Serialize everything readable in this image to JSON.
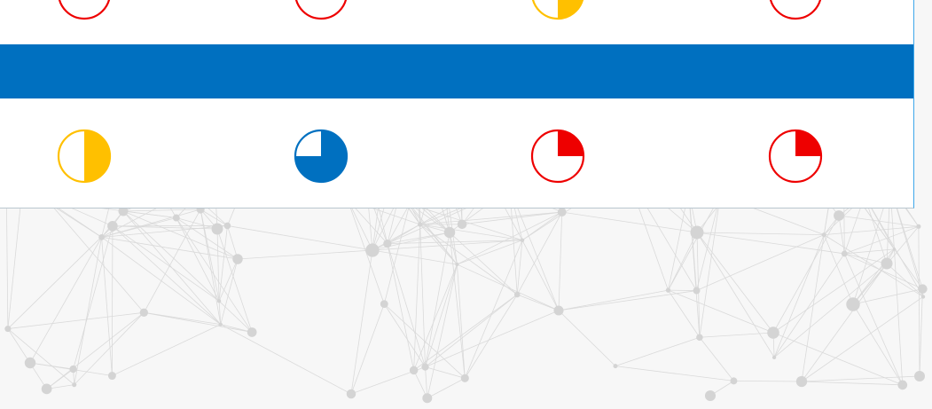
{
  "colors": {
    "band": "#0070c0",
    "yellow": "#ffc000",
    "blue": "#0070c0",
    "red": "#ee0000",
    "panel_border": "#3ea7ea"
  },
  "rows": [
    {
      "name": "top-row",
      "cells": [
        {
          "fill": 0,
          "color": "red"
        },
        {
          "fill": 0,
          "color": "red"
        },
        {
          "fill": 0.5,
          "color": "yellow"
        },
        {
          "fill": 0,
          "color": "red"
        }
      ]
    },
    {
      "name": "bottom-row",
      "cells": [
        {
          "fill": 0.5,
          "color": "yellow"
        },
        {
          "fill": 0.75,
          "color": "blue"
        },
        {
          "fill": 0.25,
          "color": "red"
        },
        {
          "fill": 0.25,
          "color": "red"
        }
      ]
    }
  ]
}
